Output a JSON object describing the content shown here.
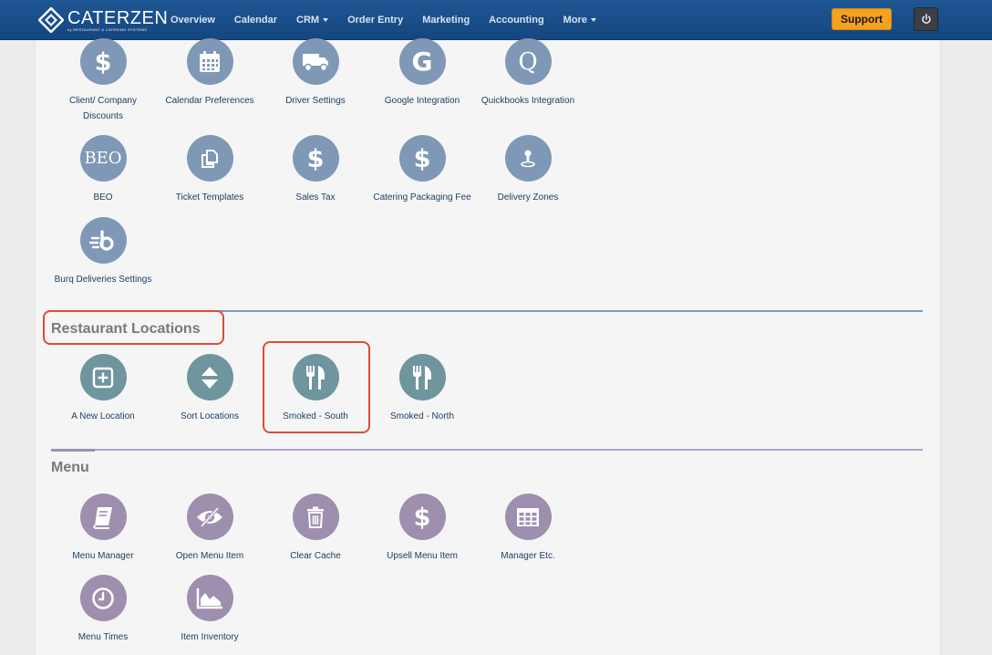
{
  "brand": {
    "name": "CATERZEN",
    "tagline": "by RESTAURANT & CATERING SYSTEMS"
  },
  "nav": {
    "items": [
      "Overview",
      "Calendar",
      "CRM",
      "Order Entry",
      "Marketing",
      "Accounting",
      "More"
    ],
    "support_label": "Support"
  },
  "settings": {
    "tiles": [
      {
        "label": "Client/ Company Discounts",
        "icon": "dollar-icon"
      },
      {
        "label": "Calendar Preferences",
        "icon": "calendar-icon"
      },
      {
        "label": "Driver Settings",
        "icon": "truck-icon"
      },
      {
        "label": "Google Integration",
        "icon": "google-icon",
        "glyph": "G"
      },
      {
        "label": "Quickbooks Integration",
        "icon": "quickbooks-icon",
        "glyph": "Q"
      },
      {
        "label": "BEO",
        "icon": "beo-icon",
        "glyph": "BEO"
      },
      {
        "label": "Ticket Templates",
        "icon": "copy-icon"
      },
      {
        "label": "Sales Tax",
        "icon": "dollar-icon"
      },
      {
        "label": "Catering Packaging Fee",
        "icon": "dollar-icon"
      },
      {
        "label": "Delivery Zones",
        "icon": "map-pin-icon"
      },
      {
        "label": "Burq Deliveries Settings",
        "icon": "burq-icon"
      }
    ]
  },
  "restaurant_locations": {
    "title": "Restaurant Locations",
    "tiles": [
      {
        "label": "A New Location",
        "icon": "plus-square-icon"
      },
      {
        "label": "Sort Locations",
        "icon": "sort-icon"
      },
      {
        "label": "Smoked - South",
        "icon": "utensils-icon"
      },
      {
        "label": "Smoked - North",
        "icon": "utensils-icon"
      }
    ]
  },
  "menu": {
    "title": "Menu",
    "tiles": [
      {
        "label": "Menu Manager",
        "icon": "book-icon"
      },
      {
        "label": "Open Menu Item",
        "icon": "eye-slash-icon"
      },
      {
        "label": "Clear Cache",
        "icon": "trash-icon"
      },
      {
        "label": "Upsell Menu Item",
        "icon": "dollar-icon"
      },
      {
        "label": "Manager Etc.",
        "icon": "table-icon"
      },
      {
        "label": "Menu Times",
        "icon": "clock-icon"
      },
      {
        "label": "Item Inventory",
        "icon": "area-chart-icon"
      }
    ]
  },
  "colors": {
    "nav_bg": "#1a4f8a",
    "support": "#f5a21d",
    "settings_icon": "#7f98b6",
    "location_icon": "#6f959f",
    "menu_icon": "#9e8fae",
    "highlight": "#dd4b3b"
  }
}
